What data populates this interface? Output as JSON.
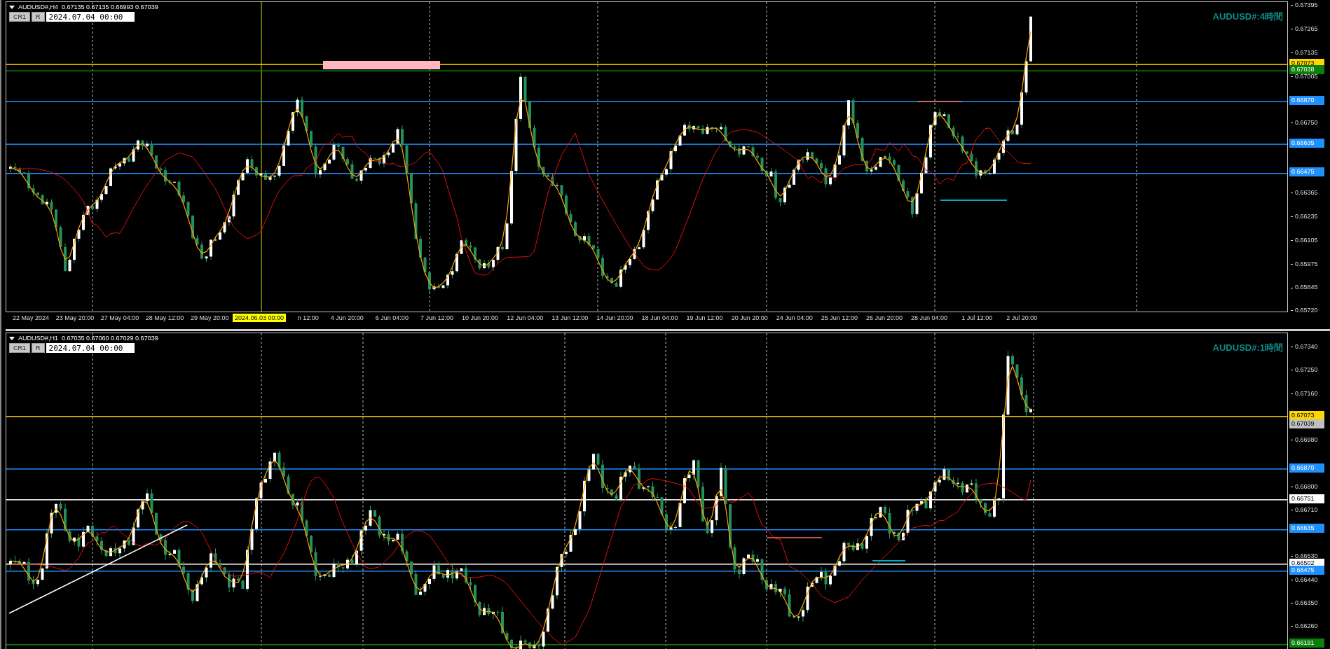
{
  "panels": [
    {
      "symbol_line": "AUDUSD#,H4  0.67135 0.67135 0.66993 0.67039",
      "buttons": [
        "CR1",
        "R"
      ],
      "date_field": "2024.07.04 00:00",
      "title": "AUDUSD#:4時間",
      "price_ticks": [
        "0.67395",
        "0.67265",
        "0.67135",
        "0.67005",
        "0.66750",
        "0.66365",
        "0.66235",
        "0.66105",
        "0.65975",
        "0.65845",
        "0.65720"
      ],
      "levels": [
        {
          "price": "0.67073",
          "color": "#ffd700",
          "line": true
        },
        {
          "price": "0.67038",
          "color": "#0a800a",
          "line": true
        },
        {
          "price": "0.66870",
          "color": "#1e90ff",
          "line": true
        },
        {
          "price": "0.66635",
          "color": "#1e90ff",
          "line": true
        },
        {
          "price": "0.66475",
          "color": "#1e90ff",
          "line": true
        }
      ],
      "crosshair_label": "2024.06.03 00:00",
      "time_labels": [
        "22 May 2024",
        "23 May 20:00",
        "27 May 04:00",
        "28 May 12:00",
        "29 May 20:00",
        "n 12:00",
        "4 Jun 20:00",
        "6 Jun 04:00",
        "7 Jun 12:00",
        "10 Jun 20:00",
        "12 Jun 04:00",
        "13 Jun 12:00",
        "14 Jun 20:00",
        "18 Jun 04:00",
        "19 Jun 12:00",
        "20 Jun 20:00",
        "24 Jun 04:00",
        "25 Jun 12:00",
        "26 Jun 20:00",
        "28 Jun 04:00",
        "1 Jul 12:00",
        "2 Jul 20:00"
      ]
    },
    {
      "symbol_line": "AUDUSD#,H1  0.67035 0.67060 0.67029 0.67039",
      "buttons": [
        "CR1",
        "R"
      ],
      "date_field": "2024.07.04 00:00",
      "title": "AUDUSD#:1時間",
      "price_ticks": [
        "0.67340",
        "0.67250",
        "0.67160",
        "0.66980",
        "0.66800",
        "0.66710",
        "0.66530",
        "0.66440",
        "0.66350",
        "0.66260"
      ],
      "levels": [
        {
          "price": "0.67073",
          "color": "#ffd700",
          "line": true
        },
        {
          "price": "0.67039",
          "color": "#c0c0c0",
          "line": false
        },
        {
          "price": "0.66870",
          "color": "#1e90ff",
          "line": true
        },
        {
          "price": "0.66751",
          "color": "#ffffff",
          "line": true
        },
        {
          "price": "0.66635",
          "color": "#1e90ff",
          "line": true
        },
        {
          "price": "0.66502",
          "color": "#ffffff",
          "line": true
        },
        {
          "price": "0.66475",
          "color": "#1e90ff",
          "line": true
        },
        {
          "price": "0.66191",
          "color": "#0a800a",
          "line": true
        }
      ]
    }
  ]
}
